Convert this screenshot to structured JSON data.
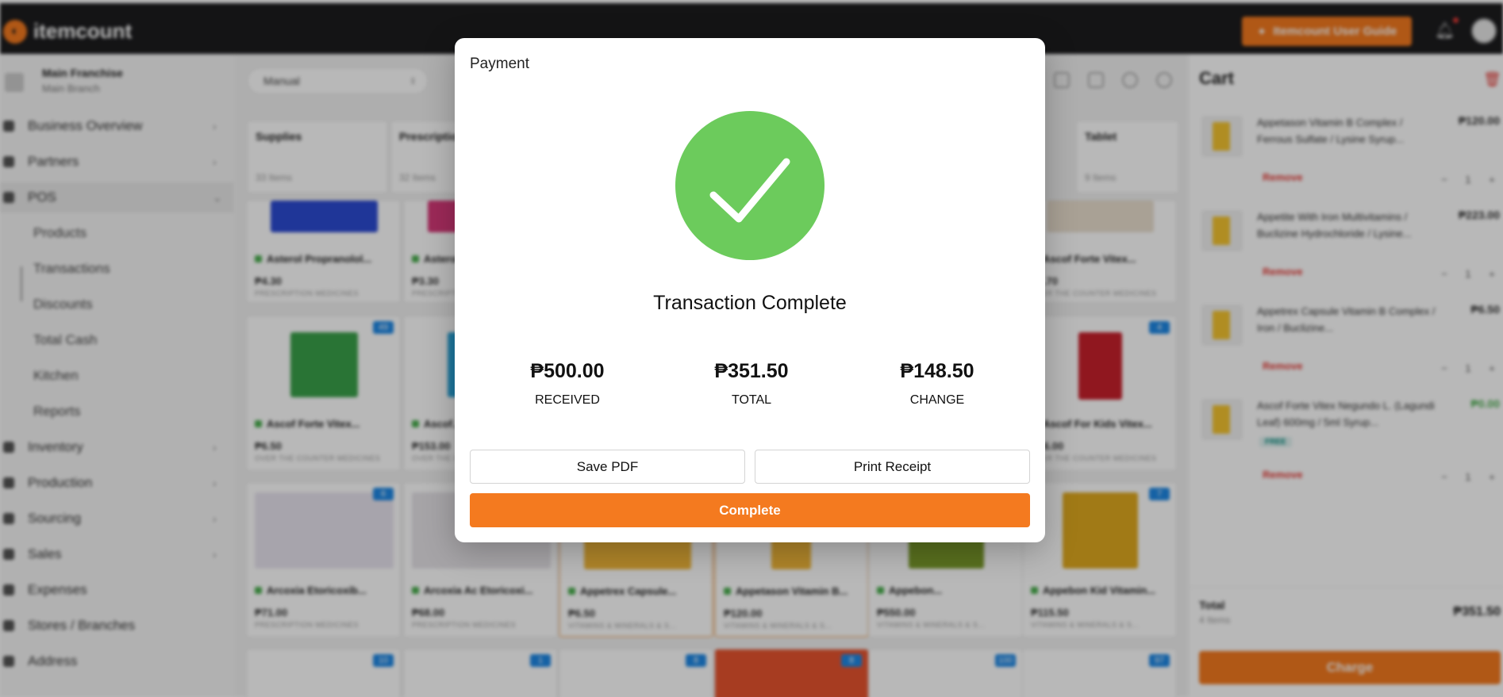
{
  "brand": {
    "name": "itemcount",
    "accent": "#f47a1f"
  },
  "header": {
    "guide_label": "Itemcount User Guide"
  },
  "sidebar": {
    "franchise": "Main Franchise",
    "branch": "Main Branch",
    "nav": [
      {
        "label": "Business Overview"
      },
      {
        "label": "Partners"
      },
      {
        "label": "POS"
      },
      {
        "label": "Inventory"
      },
      {
        "label": "Production"
      },
      {
        "label": "Sourcing"
      },
      {
        "label": "Sales"
      },
      {
        "label": "Expenses"
      },
      {
        "label": "Stores / Branches"
      },
      {
        "label": "Address"
      }
    ],
    "pos_sub": [
      "Products",
      "Transactions",
      "Discounts",
      "Total Cash",
      "Kitchen",
      "Reports"
    ]
  },
  "main": {
    "mode": "Manual",
    "categories": [
      {
        "name": "Supplies",
        "count": "33 Items"
      },
      {
        "name": "Prescription Medicines",
        "count": "32 Items"
      },
      {
        "name": "Tablet",
        "count": "9 Items"
      }
    ],
    "products": [
      {
        "name": "Asterol Propranolol...",
        "price": "₱4.30",
        "category": "PRESCRIPTION MEDICINES",
        "badge": ""
      },
      {
        "name": "Asterol...",
        "price": "₱3.30",
        "category": "PRESCRIPTION MEDICINES",
        "badge": ""
      },
      {
        "name": "Ascof Forte Vitex...",
        "price": "₱1.70",
        "category": "OVER THE COUNTER MEDICINES",
        "badge": ""
      },
      {
        "name": "Ascof Forte Vitex...",
        "price": "₱6.50",
        "category": "OVER THE COUNTER MEDICINES",
        "badge": "49"
      },
      {
        "name": "Ascof...",
        "price": "₱153.00",
        "category": "OVER THE COUNTER MEDICINES",
        "badge": ""
      },
      {
        "name": "Ascof For Kids Vitex...",
        "price": "₱56.00",
        "category": "OVER THE COUNTER MEDICINES",
        "badge": "4"
      },
      {
        "name": "Arcoxia Etoricoxib...",
        "price": "₱71.00",
        "category": "PRESCRIPTION MEDICINES",
        "badge": "6"
      },
      {
        "name": "Arcoxia Ac Etoricoxi...",
        "price": "₱68.00",
        "category": "PRESCRIPTION MEDICINES",
        "badge": ""
      },
      {
        "name": "Appetrex Capsule...",
        "price": "₱6.50",
        "category": "VITAMINS & MINERALS & S...",
        "badge": ""
      },
      {
        "name": "Appetason Vitamin B...",
        "price": "₱120.00",
        "category": "VITAMINS & MINERALS & S...",
        "badge": ""
      },
      {
        "name": "Appebon...",
        "price": "₱550.00",
        "category": "VITAMINS & MINERALS & S...",
        "badge": ""
      },
      {
        "name": "Appebon Kid Vitamin...",
        "price": "₱115.50",
        "category": "VITAMINS & MINERALS & S...",
        "badge": "7"
      }
    ],
    "bottom_badges": [
      "10",
      "1",
      "8",
      "8",
      "100",
      "97"
    ]
  },
  "cart": {
    "title": "Cart",
    "items": [
      {
        "name": "Appetason Vitamin B Complex / Ferrous Sulfate / Lysine Syrup...",
        "price": "₱120.00",
        "qty": "1",
        "remove": "Remove",
        "free": ""
      },
      {
        "name": "Appetite With Iron Multivitamins / Buclizine Hydrochloride / Lysine...",
        "price": "₱223.00",
        "qty": "1",
        "remove": "Remove",
        "free": ""
      },
      {
        "name": "Appetrex Capsule Vitamin B Complex / Iron / Buclizine...",
        "price": "₱6.50",
        "qty": "1",
        "remove": "Remove",
        "free": ""
      },
      {
        "name": "Ascof Forte Vitex Negundo L. (Lagundi Leaf) 600mg / 5ml Syrup...",
        "price": "₱0.00",
        "qty": "1",
        "remove": "Remove",
        "free": "FREE"
      }
    ],
    "total_label": "Total",
    "items_count": "4 Items",
    "total": "₱351.50",
    "charge_label": "Charge"
  },
  "modal": {
    "title": "Payment",
    "status": "Transaction Complete",
    "received": {
      "value": "₱500.00",
      "label": "RECEIVED"
    },
    "total": {
      "value": "₱351.50",
      "label": "TOTAL"
    },
    "change": {
      "value": "₱148.50",
      "label": "CHANGE"
    },
    "save_pdf_label": "Save PDF",
    "print_label": "Print Receipt",
    "complete_label": "Complete",
    "success_color": "#6ccb5c"
  }
}
